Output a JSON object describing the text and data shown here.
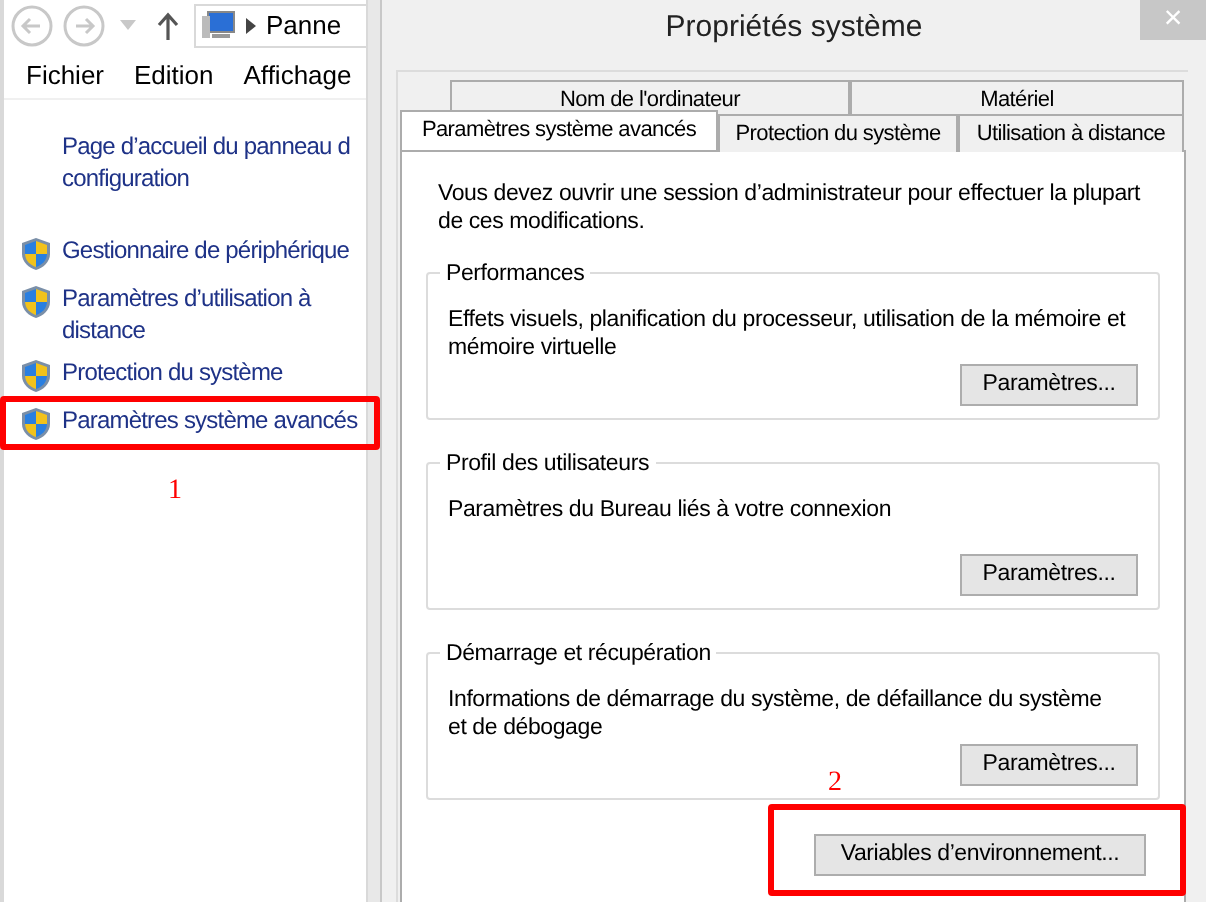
{
  "explorer": {
    "address": "Panne",
    "menu": [
      "Fichier",
      "Edition",
      "Affichage"
    ],
    "links": [
      {
        "lines": [
          "Page d’accueil du panneau d",
          "configuration"
        ],
        "kind": "home",
        "highlighted": false
      },
      {
        "lines": [
          "Gestionnaire de périphérique"
        ],
        "kind": "shield",
        "highlighted": false
      },
      {
        "lines": [
          "Paramètres d’utilisation à",
          "distance"
        ],
        "kind": "shield",
        "highlighted": false
      },
      {
        "lines": [
          "Protection du système"
        ],
        "kind": "shield",
        "highlighted": false
      },
      {
        "lines": [
          "Paramètres système avancés"
        ],
        "kind": "shield",
        "highlighted": true,
        "marker": "1"
      }
    ]
  },
  "dialog": {
    "title": "Propriétés système",
    "close": "×",
    "tab_rows": [
      [
        {
          "label": "Nom de l'ordinateur",
          "selected": false
        },
        {
          "label": "Matériel",
          "selected": false
        }
      ],
      [
        {
          "label": "Paramètres système avancés",
          "selected": true
        },
        {
          "label": "Protection du système",
          "selected": false
        },
        {
          "label": "Utilisation à distance",
          "selected": false
        }
      ]
    ],
    "notice": "Vous devez ouvrir une session d’administrateur pour effectuer la plupart de ces modifications.",
    "groups": [
      {
        "title": "Performances",
        "text": "Effets visuels, planification du processeur, utilisation de la mémoire et mémoire virtuelle",
        "button": "Paramètres..."
      },
      {
        "title": "Profil des utilisateurs",
        "text": "Paramètres du Bureau liés à votre connexion",
        "button": "Paramètres..."
      },
      {
        "title": "Démarrage et récupération",
        "text": "Informations de démarrage du système, de défaillance du système et de débogage",
        "button": "Paramètres..."
      }
    ],
    "env_button": {
      "label": "Variables d’environnement...",
      "highlighted": true,
      "marker": "2"
    }
  }
}
